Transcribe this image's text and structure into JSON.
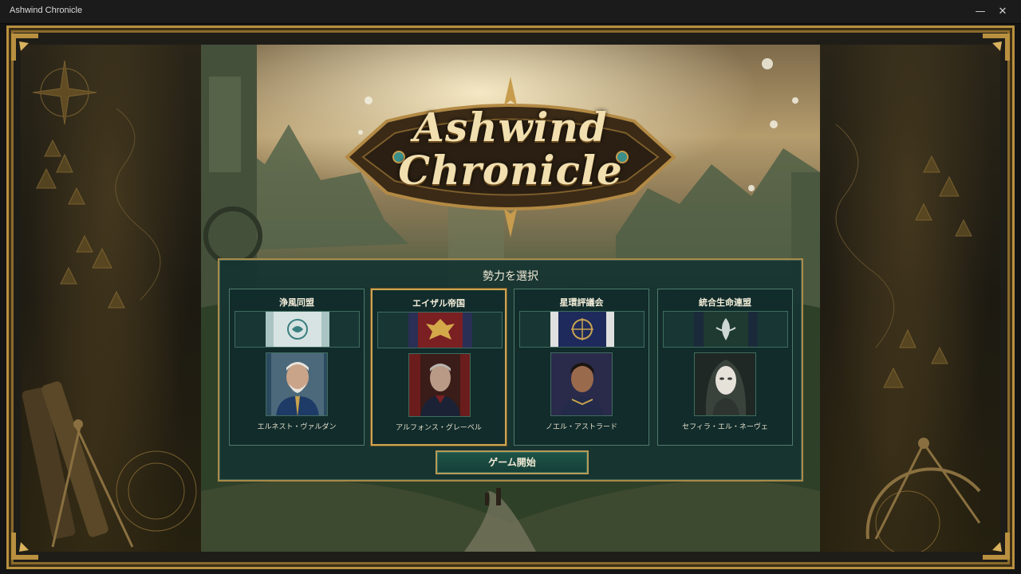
{
  "window": {
    "title": "Ashwind Chronicle",
    "minimize_glyph": "—",
    "close_glyph": "✕"
  },
  "logo": {
    "line1": "Ashwind",
    "line2": "Chronicle"
  },
  "selection": {
    "title": "勢力を選択",
    "start_button": "ゲーム開始",
    "factions": [
      {
        "name": "浄風同盟",
        "leader": "エルネスト・ヴァルダン",
        "banner_color": "#d7e3e2",
        "emblem": "wind-circle-icon",
        "selected": false
      },
      {
        "name": "エイザル帝国",
        "leader": "アルフォンス・グレーベル",
        "banner_color": "#7a1f22",
        "emblem": "double-eagle-icon",
        "selected": true
      },
      {
        "name": "星環評議会",
        "leader": "ノエル・アストラード",
        "banner_color": "#1e2a5c",
        "emblem": "star-ring-icon",
        "selected": false
      },
      {
        "name": "統合生命連盟",
        "leader": "セフィラ・エル・ネーヴェ",
        "banner_color": "#1f3a30",
        "emblem": "leaf-crest-icon",
        "selected": false
      }
    ]
  },
  "colors": {
    "frame_gold": "#b8903f",
    "panel_teal": "#16342f",
    "selected_border": "#cfa552"
  }
}
